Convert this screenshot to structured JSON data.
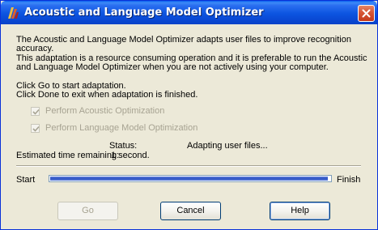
{
  "window": {
    "title": "Acoustic and Language Model Optimizer"
  },
  "description": {
    "line1": "The Acoustic and Language Model Optimizer adapts user files to improve recognition",
    "line2": "accuracy.",
    "line3": "This adaptation is a resource consuming operation and it is preferable to run the Acoustic",
    "line4": "and Language Model Optimizer when you are not actively using your computer."
  },
  "instructions": {
    "go": "Click Go to start adaptation.",
    "done": "Click Done to exit when adaptation is finished."
  },
  "options": [
    {
      "label": "Perform Acoustic Optimization",
      "checked": true,
      "enabled": false
    },
    {
      "label": "Perform Language Model Optimization",
      "checked": true,
      "enabled": false
    }
  ],
  "status": {
    "label": "Status:",
    "value": "Adapting user files..."
  },
  "eta": {
    "label": "Estimated time remaining:",
    "value": "1 second."
  },
  "progress": {
    "start_label": "Start",
    "finish_label": "Finish",
    "fraction": 0.99
  },
  "buttons": {
    "go": "Go",
    "cancel": "Cancel",
    "help": "Help"
  },
  "icons": {
    "app": "app-logo-icon",
    "close": "close-icon",
    "check": "checkmark-icon"
  },
  "colors": {
    "titlebar": "#0A49D4",
    "close_button": "#D8593A",
    "dialog_bg": "#ECE9D8",
    "progress_fill": "#3054C4",
    "disabled_text": "#A7A392"
  }
}
